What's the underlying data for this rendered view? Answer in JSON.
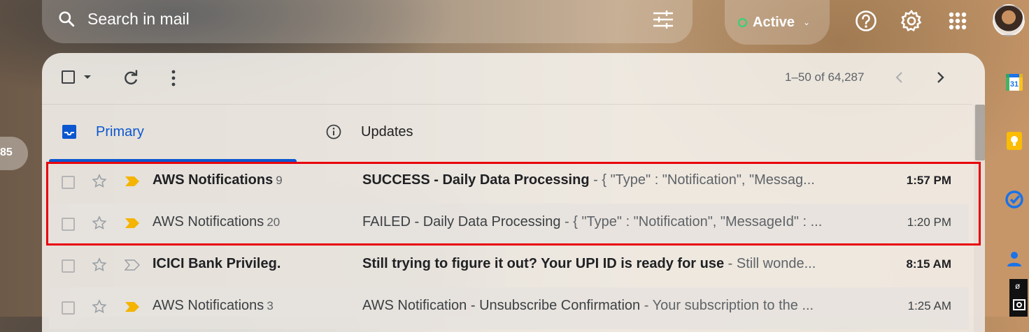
{
  "search": {
    "placeholder": "Search in mail"
  },
  "status": {
    "label": "Active"
  },
  "toolbar": {
    "pager": "1–50 of 64,287"
  },
  "tabs": [
    {
      "label": "Primary",
      "selected": true
    },
    {
      "label": "Updates",
      "selected": false
    }
  ],
  "left_badge": "85",
  "emails": [
    {
      "sender": "AWS Notifications",
      "count": "9",
      "subject": "SUCCESS - Daily Data Processing",
      "snippet": " - { \"Type\" : \"Notification\", \"Messag...",
      "time": "1:57 PM",
      "unread": true,
      "important": true
    },
    {
      "sender": "AWS Notifications",
      "count": "20",
      "subject": "FAILED - Daily Data Processing",
      "snippet": " - { \"Type\" : \"Notification\", \"MessageId\" : ...",
      "time": "1:20 PM",
      "unread": false,
      "important": true
    },
    {
      "sender": "ICICI Bank Privileg.",
      "count": "",
      "subject": "Still trying to figure it out? Your UPI ID is ready for use",
      "snippet": " - Still wonde...",
      "time": "8:15 AM",
      "unread": true,
      "important": false
    },
    {
      "sender": "AWS Notifications",
      "count": "3",
      "subject": "AWS Notification - Unsubscribe Confirmation",
      "snippet": " - Your subscription to the ...",
      "time": "1:25 AM",
      "unread": false,
      "important": true
    }
  ],
  "colors": {
    "accent": "#0b57d0",
    "highlight": "#e8000b",
    "important": "#f4b400",
    "active": "#2ed573"
  }
}
